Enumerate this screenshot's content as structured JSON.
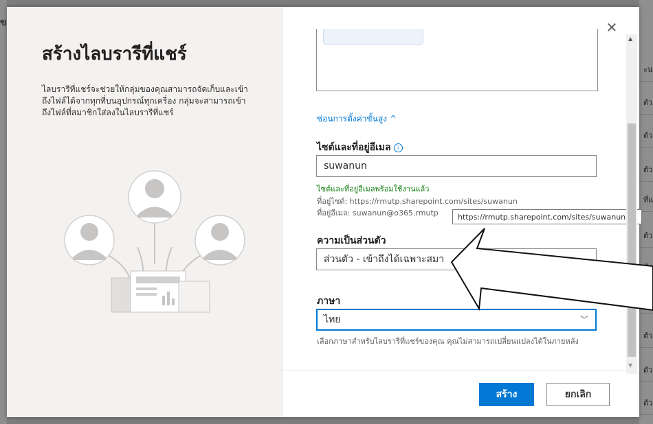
{
  "dialog": {
    "title": "สร้างไลบรารีที่แชร์",
    "description": "ไลบรารีที่แชร์จะช่วยให้กลุ่มของคุณสามารถจัดเก็บและเข้าถึงไฟล์ได้จากทุกที่บนอุปกรณ์ทุกเครื่อง กลุ่มจะสามารถเข้าถึงไฟล์ที่สมาชิกใส่ลงในไลบรารีที่แชร์",
    "close_glyph": "✕"
  },
  "background": {
    "left_char": "ข",
    "right_items": [
      "ะน",
      "ตัว",
      "ตัว",
      "ตัว",
      "ที่แ",
      "ตัว",
      "ตัว",
      "ตัว",
      "ตัว",
      "ตัว",
      "ตัว"
    ]
  },
  "advanced": {
    "link_label": "ซ่อนการตั้งค่าขั้นสูง ^"
  },
  "site": {
    "label": "ไซต์และที่อยู่อีเมล",
    "info_glyph": "i",
    "value": "suwanun",
    "ok_message": "ไซต์และที่อยู่อีเมลพร้อมใช้งานแล้ว",
    "site_address": "ที่อยู่ไซต์: https://rmutp.sharepoint.com/sites/suwanun",
    "email_address": "ที่อยู่อีเมล: suwanun@o365.rmutp",
    "tooltip": "https://rmutp.sharepoint.com/sites/suwanun"
  },
  "privacy": {
    "label": "ความเป็นส่วนตัว",
    "value": "ส่วนตัว - เข้าถึงได้เฉพาะสมา"
  },
  "language": {
    "label": "ภาษา",
    "value": "ไทย",
    "chevron": "﹀",
    "help": "เลือกภาษาสำหรับไลบรารีที่แชร์ของคุณ คุณไม่สามารถเปลี่ยนแปลงได้ในภายหลัง"
  },
  "footer": {
    "create_label": "สร้าง",
    "cancel_label": "ยกเลิก"
  },
  "colors": {
    "accent": "#0078d4",
    "success": "#107c10"
  }
}
